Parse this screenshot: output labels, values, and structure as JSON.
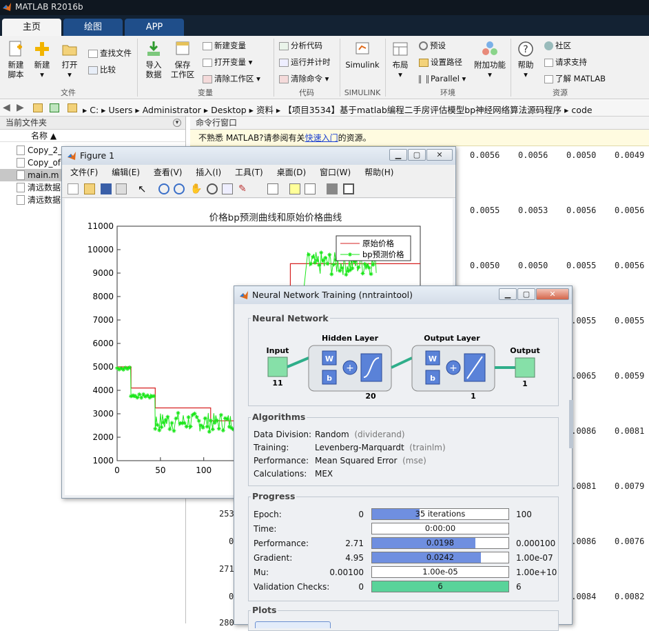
{
  "app": {
    "title": "MATLAB R2016b"
  },
  "tabs": [
    {
      "label": "主页"
    },
    {
      "label": "绘图"
    },
    {
      "label": "APP"
    }
  ],
  "ribbon": {
    "file": {
      "new_script": "新建\n脚本",
      "new": "新建",
      "open": "打开",
      "find_files": "查找文件",
      "compare": "比较",
      "group": "文件"
    },
    "variable": {
      "import": "导入\n数据",
      "save_ws": "保存\n工作区",
      "new_var": "新建变量",
      "open_var": "打开变量",
      "clear_ws": "清除工作区",
      "group": "变量"
    },
    "code": {
      "analyze": "分析代码",
      "run_time": "运行并计时",
      "clear_cmd": "清除命令",
      "group": "代码"
    },
    "simulink": {
      "label": "Simulink",
      "group": "SIMULINK"
    },
    "env": {
      "layout": "布局",
      "prefs": "预设",
      "set_path": "设置路径",
      "parallel": "Parallel",
      "addons": "附加功能",
      "group": "环境"
    },
    "resources": {
      "help": "帮助",
      "community": "社区",
      "support": "请求支持",
      "learn": "了解 MATLAB",
      "group": "资源"
    }
  },
  "address": {
    "parts": [
      "C:",
      "Users",
      "Administrator",
      "Desktop",
      "资料",
      "【项目3534】基于matlab编程二手房评估模型bp神经网络算法源码程序",
      "code"
    ]
  },
  "current_folder": {
    "title": "当前文件夹",
    "col_name": "名称 ▲",
    "files": [
      {
        "name": "Copy_2_",
        "selected": false
      },
      {
        "name": "Copy_of",
        "selected": false
      },
      {
        "name": "main.m",
        "selected": true
      },
      {
        "name": "清远数据",
        "selected": false
      },
      {
        "name": "清远数据",
        "selected": false
      }
    ]
  },
  "command_window": {
    "title": "命令行窗口",
    "note_prefix": "不熟悉 MATLAB?请参阅有关",
    "note_link": "快速入门",
    "note_suffix": "的资源。",
    "rows": [
      [
        "0.0056",
        "0.0056",
        "0.0050",
        "0.0049"
      ],
      [
        "0.0055",
        "0.0053",
        "0.0056",
        "0.0056"
      ],
      [
        "0.0050",
        "0.0050",
        "0.0055",
        "0.0056"
      ],
      [
        "0.0055",
        "0.0055"
      ],
      [
        "0.0065",
        "0.0059"
      ],
      [
        "0.0086",
        "0.0081"
      ],
      [
        "0.0081",
        "0.0079"
      ],
      [
        "0.0086",
        "0.0076"
      ],
      [
        "0.0084",
        "0.0082"
      ]
    ],
    "left_fragments": [
      "253",
      "0",
      "271",
      "0",
      "280"
    ]
  },
  "figure": {
    "title": "Figure 1",
    "menu": [
      "文件(F)",
      "编辑(E)",
      "查看(V)",
      "插入(I)",
      "工具(T)",
      "桌面(D)",
      "窗口(W)",
      "帮助(H)"
    ],
    "chart_data": {
      "type": "line",
      "title": "价格bp预测曲线和原始价格曲线",
      "xlabel": "",
      "ylabel": "",
      "xlim": [
        0,
        350
      ],
      "ylim": [
        1000,
        11000
      ],
      "yticks": [
        "11000",
        "10000",
        "9000",
        "8000",
        "7000",
        "6000",
        "5000",
        "4000",
        "3000",
        "2000",
        "1000"
      ],
      "xticks": [
        "0",
        "50",
        "100"
      ],
      "legend": [
        "原始价格",
        "bp预测价格"
      ],
      "legend_position": "top-right",
      "series": [
        {
          "name": "原始价格",
          "color": "#d62020",
          "x": [
            0,
            16,
            16,
            44,
            44,
            108,
            108,
            200,
            200,
            350
          ],
          "y": [
            5000,
            5000,
            4100,
            4100,
            3250,
            3250,
            2700,
            2700,
            9400,
            9400
          ]
        },
        {
          "name": "bp预测价格",
          "color": "#19e619",
          "style": "star-markers"
        }
      ]
    }
  },
  "nntool": {
    "title": "Neural Network Training (nntraintool)",
    "network": {
      "title": "Neural Network",
      "input": "Input",
      "input_n": "11",
      "hidden": "Hidden Layer",
      "hidden_n": "20",
      "output_layer": "Output Layer",
      "output_layer_n": "1",
      "output": "Output",
      "output_n": "1",
      "w": "W",
      "b": "b"
    },
    "algorithms": {
      "title": "Algorithms",
      "rows": [
        {
          "k": "Data Division:",
          "v": "Random",
          "f": "(dividerand)"
        },
        {
          "k": "Training:",
          "v": "Levenberg-Marquardt",
          "f": "(trainlm)"
        },
        {
          "k": "Performance:",
          "v": "Mean Squared Error",
          "f": "(mse)"
        },
        {
          "k": "Calculations:",
          "v": "MEX",
          "f": ""
        }
      ]
    },
    "progress": {
      "title": "Progress",
      "rows": [
        {
          "k": "Epoch:",
          "min": "0",
          "val": "35 iterations",
          "max": "100",
          "frac": 0.35,
          "color": "#6f8fe0"
        },
        {
          "k": "Time:",
          "min": "",
          "val": "0:00:00",
          "max": "",
          "frac": 0,
          "color": "#6f8fe0"
        },
        {
          "k": "Performance:",
          "min": "2.71",
          "val": "0.0198",
          "max": "0.000100",
          "frac": 0.76,
          "color": "#6f8fe0"
        },
        {
          "k": "Gradient:",
          "min": "4.95",
          "val": "0.0242",
          "max": "1.00e-07",
          "frac": 0.8,
          "color": "#6f8fe0"
        },
        {
          "k": "Mu:",
          "min": "0.00100",
          "val": "1.00e-05",
          "max": "1.00e+10",
          "frac": 0,
          "color": "#6f8fe0"
        },
        {
          "k": "Validation Checks:",
          "min": "0",
          "val": "6",
          "max": "6",
          "frac": 1,
          "color": "#59d39a"
        }
      ]
    },
    "plots": {
      "title": "Plots"
    }
  }
}
